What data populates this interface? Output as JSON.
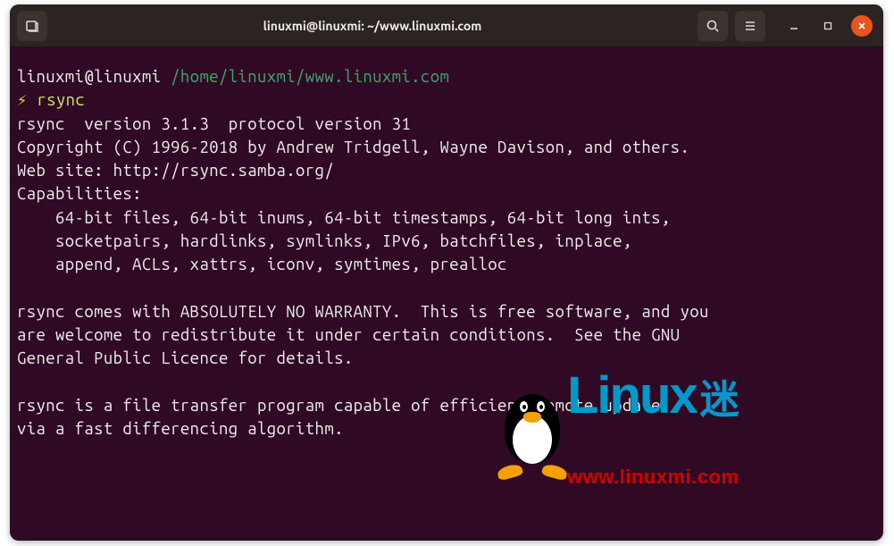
{
  "window": {
    "title": "linuxmi@linuxmi: ~/www.linuxmi.com"
  },
  "prompt": {
    "user_host": "linuxmi@linuxmi",
    "path": "/home/linuxmi/www.linuxmi.com",
    "symbol": "⚡",
    "command": "rsync"
  },
  "output": {
    "l1": "rsync  version 3.1.3  protocol version 31",
    "l2": "Copyright (C) 1996-2018 by Andrew Tridgell, Wayne Davison, and others.",
    "l3": "Web site: http://rsync.samba.org/",
    "l4": "Capabilities:",
    "l5": "    64-bit files, 64-bit inums, 64-bit timestamps, 64-bit long ints,",
    "l6": "    socketpairs, hardlinks, symlinks, IPv6, batchfiles, inplace,",
    "l7": "    append, ACLs, xattrs, iconv, symtimes, prealloc",
    "l8": "",
    "l9": "rsync comes with ABSOLUTELY NO WARRANTY.  This is free software, and you",
    "l10": "are welcome to redistribute it under certain conditions.  See the GNU",
    "l11": "General Public Licence for details.",
    "l12": "",
    "l13": "rsync is a file transfer program capable of efficient remote update",
    "l14": "via a fast differencing algorithm."
  },
  "watermark": {
    "brand": "Linux",
    "brand_suffix": "迷",
    "url": "www.linuxmi.com"
  }
}
